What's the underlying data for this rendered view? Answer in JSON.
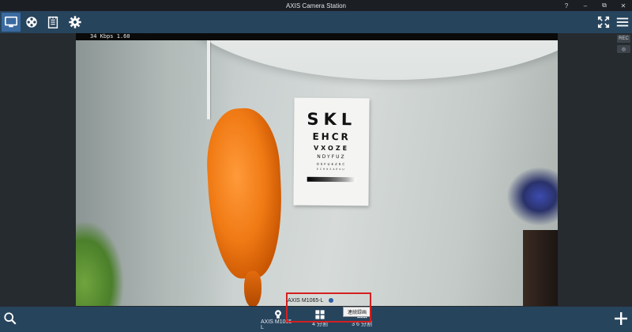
{
  "window": {
    "title": "AXIS Camera Station",
    "controls": [
      "?",
      "–",
      "⧉",
      "✕"
    ]
  },
  "toolbar": {
    "tools": [
      {
        "name": "live-view",
        "icon": "monitor-icon",
        "active": true
      },
      {
        "name": "recordings",
        "icon": "film-reel-icon",
        "active": false
      },
      {
        "name": "logs",
        "icon": "notepad-icon",
        "active": false
      },
      {
        "name": "settings",
        "icon": "gear-icon",
        "active": false
      }
    ],
    "right_icons": [
      "fullscreen-icon",
      "menu-icon"
    ]
  },
  "video": {
    "stream_info": "34 Kbps  1.60",
    "camera_label": "AXIS M1065-L",
    "eye_chart": {
      "line1": "SKL",
      "line2": "EHCR",
      "line3": "VXOZE",
      "line4": "NDYFUZ",
      "line5": "OSFUEZRC",
      "line6": "ECHRSAEVU"
    },
    "side_controls": {
      "rec": "REC",
      "pin": "◎"
    }
  },
  "bottombar": {
    "left_icon": "search-icon",
    "views": [
      {
        "label": "AXIS M1065-L",
        "icon": "camera-icon"
      },
      {
        "label": "4 分割",
        "icon": "grid-4-icon"
      },
      {
        "label": "3 6 分割",
        "icon": "grid-36-icon"
      }
    ],
    "tooltip": "連続録画",
    "right_icon": "plus-icon"
  },
  "colors": {
    "accent_bar": "#27445d",
    "active_tool": "#3a6aa0",
    "highlight": "#d42020",
    "rec_dot": "#2d5fa3"
  }
}
